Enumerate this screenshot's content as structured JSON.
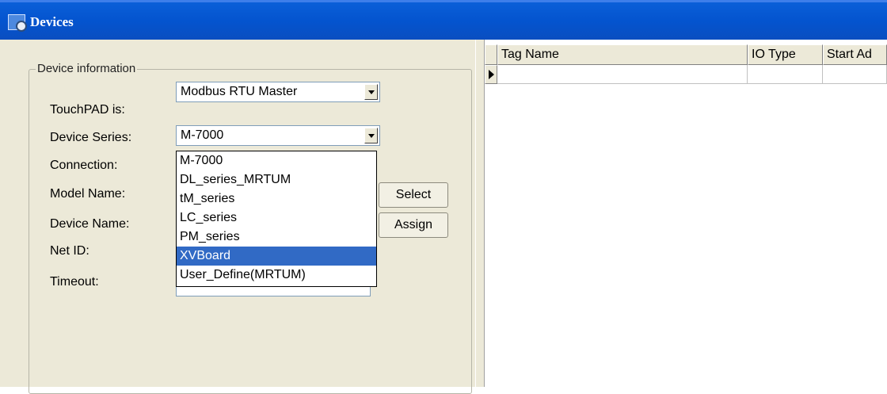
{
  "window": {
    "title": "Devices",
    "icon": "devices-app-icon"
  },
  "device_info": {
    "legend": "Device information",
    "touchpad_label": "TouchPAD is:",
    "touchpad_value": "Modbus RTU Master",
    "series_label": "Device Series:",
    "series_value": "M-7000",
    "connection_label": "Connection:",
    "model_label": "Model Name:",
    "device_name_label": "Device Name:",
    "net_id_label": "Net ID:",
    "timeout_label": "Timeout:",
    "select_button": "Select",
    "assign_button": "Assign"
  },
  "series_dropdown": {
    "options": [
      "M-7000",
      "DL_series_MRTUM",
      "tM_series",
      "LC_series",
      "PM_series",
      "XVBoard",
      "User_Define(MRTUM)"
    ],
    "highlighted": "XVBoard"
  },
  "tag_grid": {
    "columns": [
      "Tag Name",
      "IO Type",
      "Start Ad"
    ],
    "rows": [
      [
        "",
        "",
        ""
      ]
    ]
  },
  "colors": {
    "titlebar": "#0454cf",
    "face": "#ece9d8",
    "selection": "#316ac5"
  }
}
